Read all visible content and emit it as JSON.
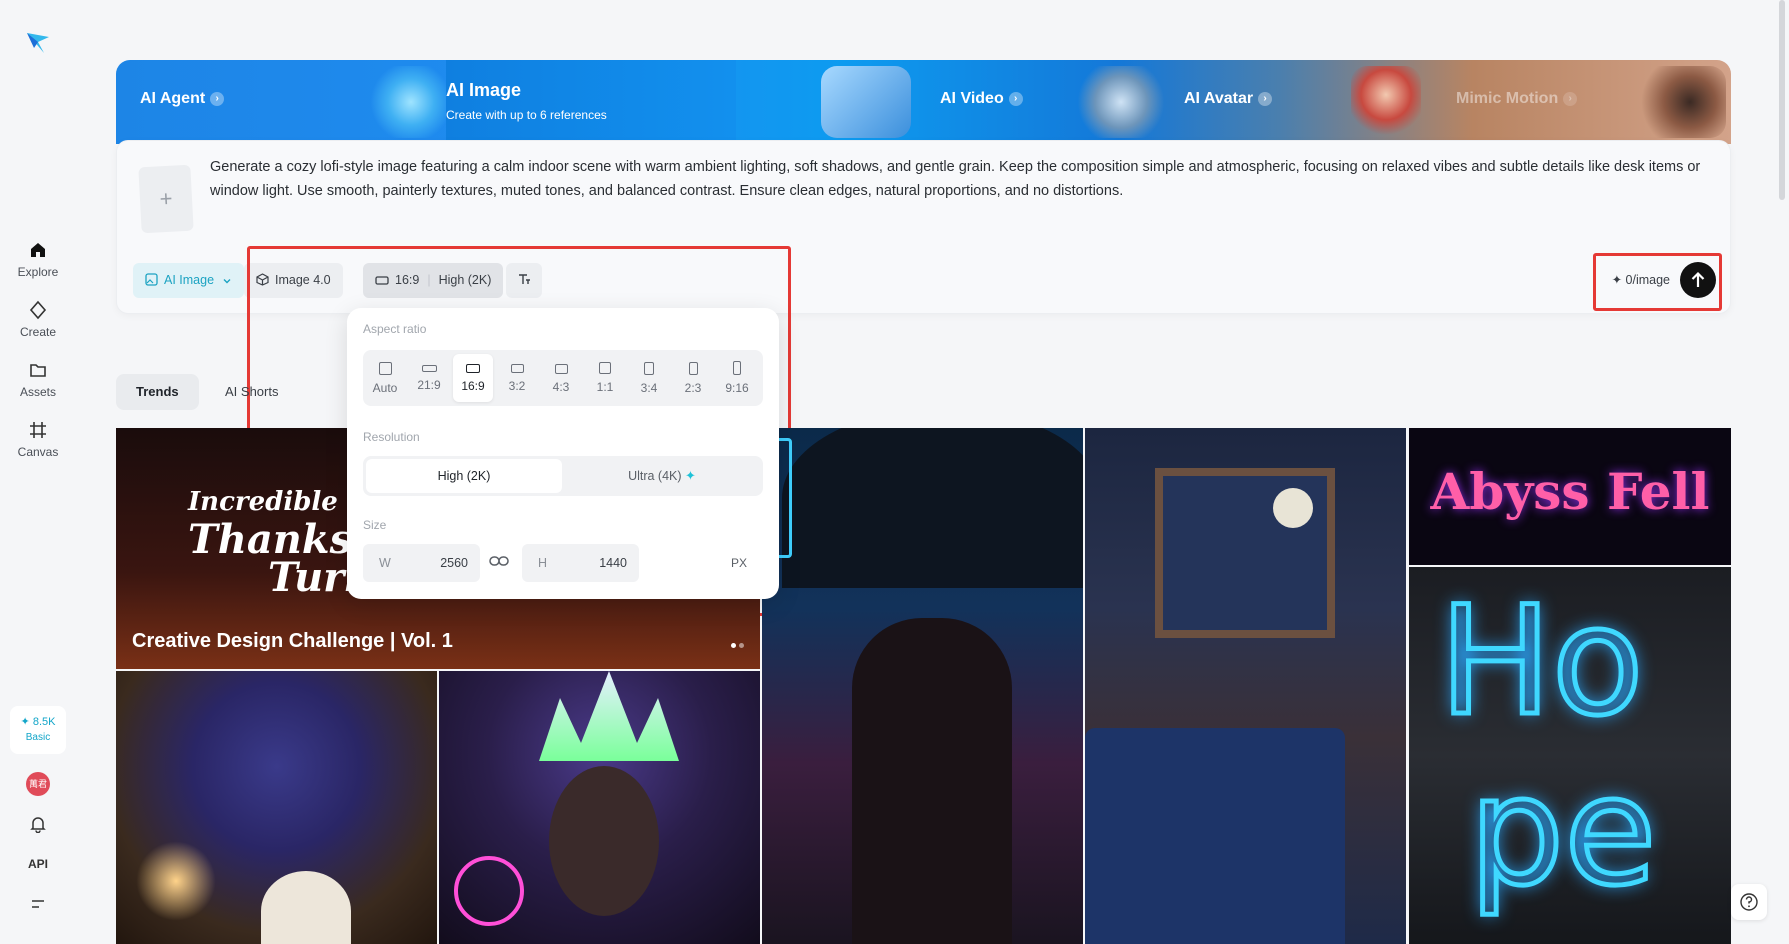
{
  "nav": {
    "items": [
      {
        "label": "Explore",
        "icon": "home-icon"
      },
      {
        "label": "Create",
        "icon": "diamond-icon"
      },
      {
        "label": "Assets",
        "icon": "folder-icon"
      },
      {
        "label": "Canvas",
        "icon": "canvas-icon"
      }
    ],
    "credits_value": "✦ 8.5K",
    "credits_plan": "Basic",
    "avatar_text": "萬君",
    "api_label": "API"
  },
  "hero": {
    "agent": "AI Agent",
    "image_title": "AI Image",
    "image_sub": "Create with up to 6 references",
    "video": "AI Video",
    "avatar": "AI Avatar",
    "mimic": "Mimic Motion",
    "arrow": "›"
  },
  "prompt": {
    "add_symbol": "+",
    "text": "Generate a cozy lofi-style image featuring a calm indoor scene with warm ambient lighting, soft shadows, and gentle grain. Keep the composition simple and atmospheric, focusing on relaxed vibes and subtle details like desk items or window light. Use smooth, painterly textures, muted tones, and balanced contrast. Ensure clean edges, natural proportions, and no distortions.",
    "mode": "AI Image",
    "model": "Image 4.0",
    "ratio": "16:9",
    "quality": "High (2K)",
    "cost": "✦ 0/image"
  },
  "popup": {
    "aspect_label": "Aspect ratio",
    "ratios": [
      "Auto",
      "21:9",
      "16:9",
      "3:2",
      "4:3",
      "1:1",
      "3:4",
      "2:3",
      "9:16"
    ],
    "selected_ratio": "16:9",
    "resolution_label": "Resolution",
    "res_high": "High (2K)",
    "res_ultra": "Ultra (4K)",
    "size_label": "Size",
    "w_label": "W",
    "w_value": "2560",
    "h_label": "H",
    "h_value": "1440",
    "unit": "PX"
  },
  "tabs": [
    "Trends",
    "AI Shorts"
  ],
  "gallery": {
    "featured_title": "Creative Design Challenge | Vol. 1",
    "featured_art_l1": "Incredible",
    "featured_art_l2": "Thanksgi",
    "featured_art_l3": "Turk",
    "abyss_text": "Abyss Fell",
    "hope_l1": "Ho",
    "hope_l2": "pe"
  },
  "colors": {
    "accent": "#1ca3c2",
    "highlight": "#e53935",
    "hero_blue": "#1290ee"
  }
}
